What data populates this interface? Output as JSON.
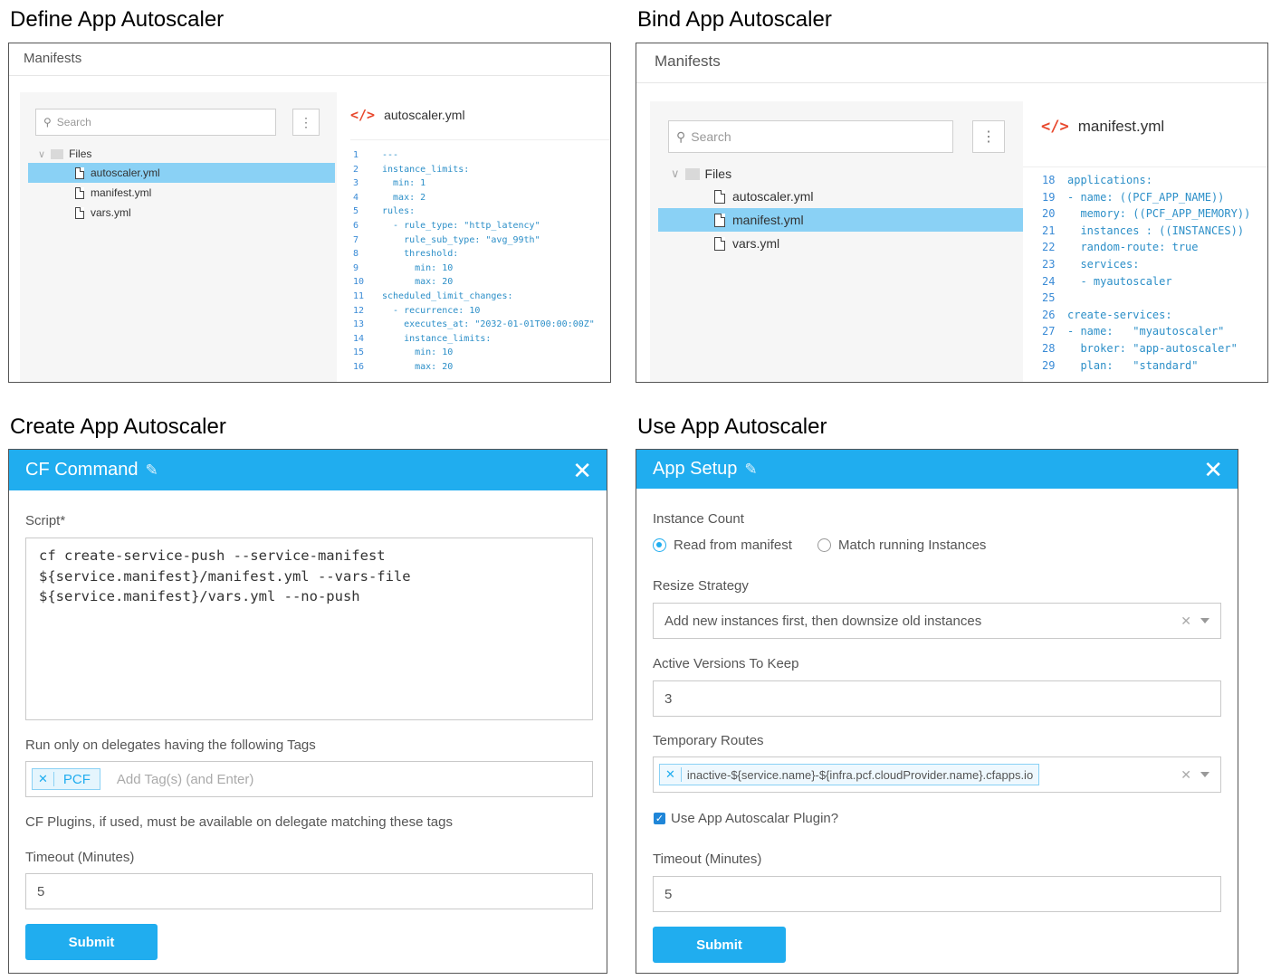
{
  "titles": {
    "define": "Define App Autoscaler",
    "bind": "Bind App Autoscaler",
    "create": "Create App Autoscaler",
    "use": "Use App Autoscaler"
  },
  "define_panel": {
    "header": "Manifests",
    "search_placeholder": "Search",
    "folder": "Files",
    "files": [
      "autoscaler.yml",
      "manifest.yml",
      "vars.yml"
    ],
    "selected_file": "autoscaler.yml",
    "editor_title": "autoscaler.yml",
    "code": [
      {
        "n": "1",
        "t": "---"
      },
      {
        "n": "2",
        "t": "instance_limits:"
      },
      {
        "n": "3",
        "t": "  min: 1"
      },
      {
        "n": "4",
        "t": "  max: 2"
      },
      {
        "n": "5",
        "t": "rules:"
      },
      {
        "n": "6",
        "t": "  - rule_type: \"http_latency\""
      },
      {
        "n": "7",
        "t": "    rule_sub_type: \"avg_99th\""
      },
      {
        "n": "8",
        "t": "    threshold:"
      },
      {
        "n": "9",
        "t": "      min: 10"
      },
      {
        "n": "10",
        "t": "      max: 20"
      },
      {
        "n": "11",
        "t": "scheduled_limit_changes:"
      },
      {
        "n": "12",
        "t": "  - recurrence: 10"
      },
      {
        "n": "13",
        "t": "    executes_at: \"2032-01-01T00:00:00Z\""
      },
      {
        "n": "14",
        "t": "    instance_limits:"
      },
      {
        "n": "15",
        "t": "      min: 10"
      },
      {
        "n": "16",
        "t": "      max: 20"
      }
    ]
  },
  "bind_panel": {
    "header": "Manifests",
    "search_placeholder": "Search",
    "folder": "Files",
    "files": [
      "autoscaler.yml",
      "manifest.yml",
      "vars.yml"
    ],
    "selected_file": "manifest.yml",
    "editor_title": "manifest.yml",
    "code": [
      {
        "n": "18",
        "t": "applications:"
      },
      {
        "n": "19",
        "t": "- name: ((PCF_APP_NAME))"
      },
      {
        "n": "20",
        "t": "  memory: ((PCF_APP_MEMORY))"
      },
      {
        "n": "21",
        "t": "  instances : ((INSTANCES))"
      },
      {
        "n": "22",
        "t": "  random-route: true"
      },
      {
        "n": "23",
        "t": "  services:"
      },
      {
        "n": "24",
        "t": "  - myautoscaler"
      },
      {
        "n": "25",
        "t": ""
      },
      {
        "n": "26",
        "t": "create-services:"
      },
      {
        "n": "27",
        "t": "- name:   \"myautoscaler\""
      },
      {
        "n": "28",
        "t": "  broker: \"app-autoscaler\""
      },
      {
        "n": "29",
        "t": "  plan:   \"standard\""
      }
    ]
  },
  "cf_command": {
    "title": "CF Command",
    "script_label": "Script*",
    "script_lines": [
      "cf create-service-push --service-manifest",
      "${service.manifest}/manifest.yml  --vars-file",
      "${service.manifest}/vars.yml --no-push"
    ],
    "tags_label": "Run only on delegates having the following Tags",
    "tag": "PCF",
    "tag_placeholder": "Add Tag(s) (and Enter)",
    "plugins_note": "CF Plugins, if used, must be available on delegate matching these tags",
    "timeout_label": "Timeout (Minutes)",
    "timeout_value": "5",
    "submit": "Submit"
  },
  "app_setup": {
    "title": "App Setup",
    "instance_count_label": "Instance Count",
    "radio_manifest": "Read from manifest",
    "radio_running": "Match running Instances",
    "resize_label": "Resize Strategy",
    "resize_value": "Add new instances first, then downsize old instances",
    "versions_label": "Active Versions To Keep",
    "versions_value": "3",
    "routes_label": "Temporary Routes",
    "route_value": "inactive-${service.name}-${infra.pcf.cloudProvider.name}.cfapps.io",
    "plugin_checkbox": "Use App Autoscalar Plugin?",
    "timeout_label": "Timeout (Minutes)",
    "timeout_value": "5",
    "submit": "Submit"
  },
  "colors": {
    "accent": "#20adef",
    "selected_row": "#8ad1f5",
    "code_text": "#2c8fc8",
    "code_tag": "#e8482d"
  }
}
